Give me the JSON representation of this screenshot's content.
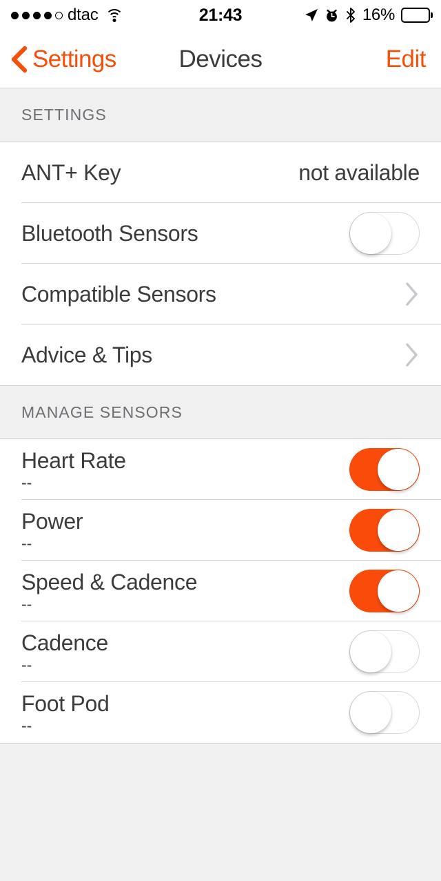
{
  "status_bar": {
    "signal_dots_filled": 4,
    "signal_dots_total": 5,
    "carrier": "dtac",
    "wifi_icon": "wifi-icon",
    "time": "21:43",
    "location_icon": "location-arrow-icon",
    "alarm_icon": "alarm-clock-icon",
    "bluetooth_icon": "bluetooth-icon",
    "battery_percent": "16%",
    "battery_level": 16,
    "battery_color": "#ff1a12"
  },
  "nav_bar": {
    "back_label": "Settings",
    "back_icon": "chevron-left-icon",
    "title": "Devices",
    "edit_label": "Edit",
    "accent_color": "#f4500a"
  },
  "sections": [
    {
      "header": "SETTINGS",
      "rows": [
        {
          "title": "ANT+ Key",
          "value": "not available",
          "type": "value"
        },
        {
          "title": "Bluetooth Sensors",
          "type": "toggle",
          "toggle_on": false
        },
        {
          "title": "Compatible Sensors",
          "type": "disclosure",
          "icon": "chevron-right-icon"
        },
        {
          "title": "Advice & Tips",
          "type": "disclosure",
          "icon": "chevron-right-icon"
        }
      ]
    },
    {
      "header": "MANAGE SENSORS",
      "rows": [
        {
          "title": "Heart Rate",
          "subtitle": "--",
          "type": "toggle",
          "toggle_on": true
        },
        {
          "title": "Power",
          "subtitle": "--",
          "type": "toggle",
          "toggle_on": true
        },
        {
          "title": "Speed & Cadence",
          "subtitle": "--",
          "type": "toggle",
          "toggle_on": true
        },
        {
          "title": "Cadence",
          "subtitle": "--",
          "type": "toggle",
          "toggle_on": false
        },
        {
          "title": "Foot Pod",
          "subtitle": "--",
          "type": "toggle",
          "toggle_on": false
        }
      ]
    }
  ],
  "theme": {
    "toggle_on_color": "#fa4b0a",
    "separator_color": "#d3d3d3",
    "group_background": "#f0f0f0",
    "text_color": "#3c3c3c",
    "header_text_color": "#6e6e73"
  }
}
